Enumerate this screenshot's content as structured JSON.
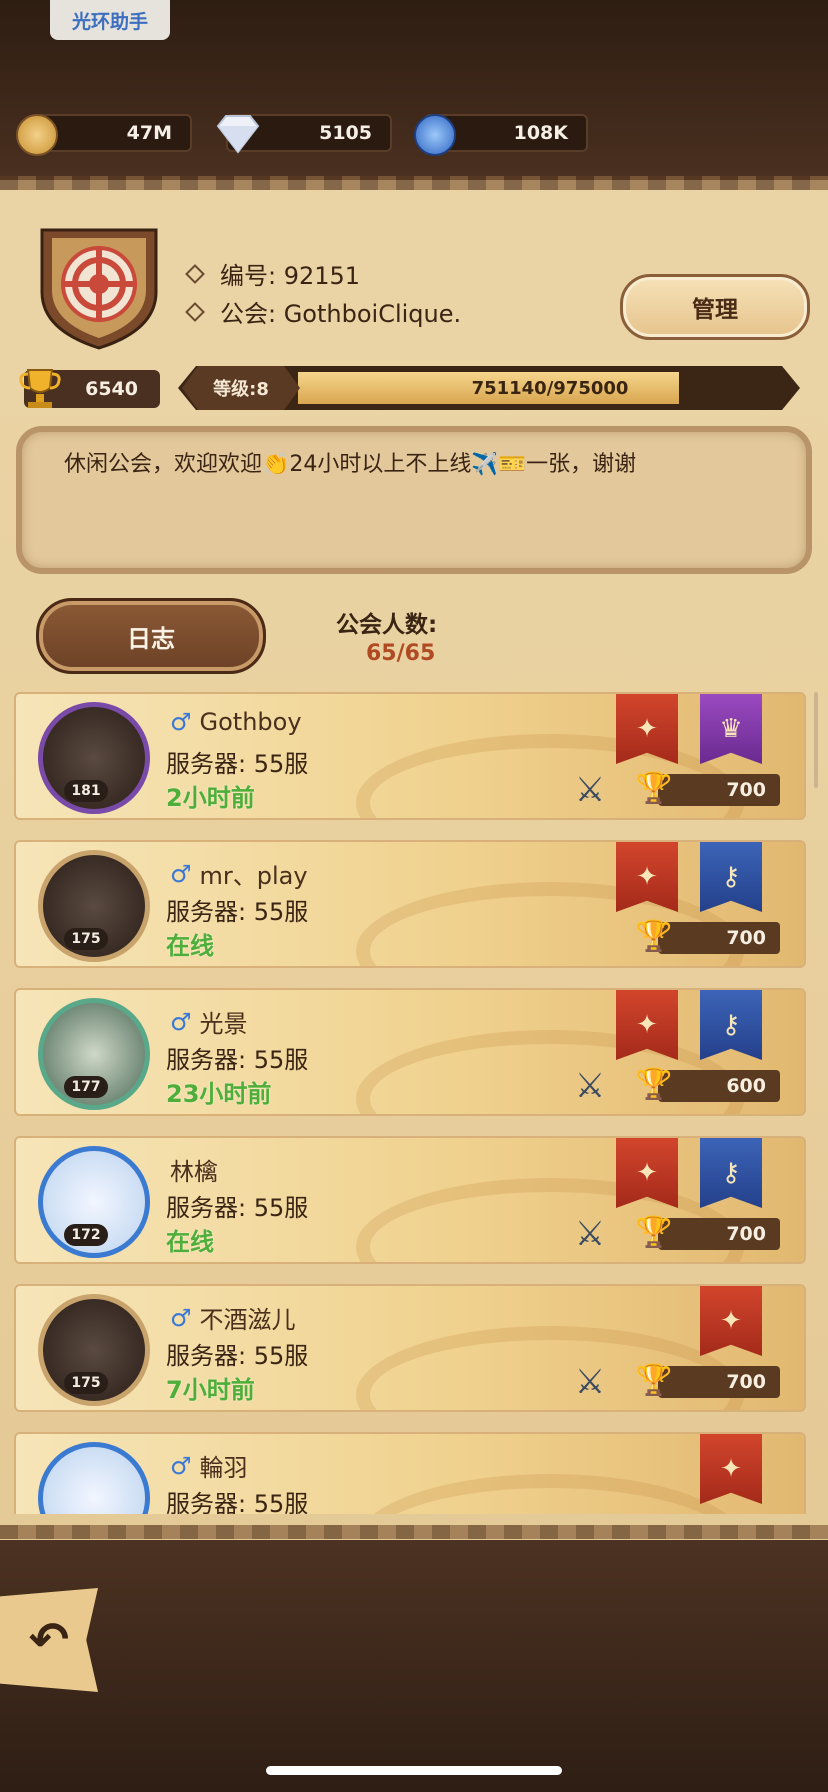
{
  "system": {
    "assistant_label": "光环助手"
  },
  "resources": [
    {
      "icon": "gold-coin-icon",
      "value": "47M"
    },
    {
      "icon": "diamond-icon",
      "value": "5105"
    },
    {
      "icon": "blue-gem-icon",
      "value": "108K"
    }
  ],
  "guild": {
    "id_label": "编号: 92151",
    "name_label": "公会: GothboiClique.",
    "manage_label": "管理",
    "trophies": "6540",
    "level_label": "等级:8",
    "xp_text": "751140/975000",
    "xp_fraction": 0.7704,
    "notice": "休闲公会，欢迎欢迎👏24小时以上不上线✈️🎫一张，谢谢",
    "log_label": "日志",
    "member_count_label": "公会人数:",
    "member_count": "65/65"
  },
  "members": [
    {
      "name": "Gothboy",
      "male": true,
      "level": "181",
      "server": "服务器: 55服",
      "status": "2小时前",
      "points": "700",
      "banners": [
        "red",
        "purple"
      ],
      "crossed_swords": true,
      "frame": "purple"
    },
    {
      "name": "mr、play",
      "male": true,
      "level": "175",
      "server": "服务器: 55服",
      "status": "在线",
      "points": "700",
      "banners": [
        "red",
        "blue"
      ],
      "crossed_swords": false,
      "frame": "gold"
    },
    {
      "name": "光景",
      "male": true,
      "level": "177",
      "server": "服务器: 55服",
      "status": "23小时前",
      "points": "600",
      "banners": [
        "red",
        "blue"
      ],
      "crossed_swords": true,
      "frame": "green"
    },
    {
      "name": "林檎",
      "male": false,
      "level": "172",
      "server": "服务器: 55服",
      "status": "在线",
      "points": "700",
      "banners": [
        "red",
        "blue"
      ],
      "crossed_swords": true,
      "frame": "blue"
    },
    {
      "name": "不酒滋儿",
      "male": true,
      "level": "175",
      "server": "服务器: 55服",
      "status": "7小时前",
      "points": "700",
      "banners": [
        "red"
      ],
      "crossed_swords": true,
      "frame": "gold"
    },
    {
      "name": "輪羽",
      "male": true,
      "level": "",
      "server": "服务器: 55服",
      "status": "",
      "points": "",
      "banners": [
        "red"
      ],
      "crossed_swords": true,
      "frame": "blue"
    }
  ],
  "colors": {
    "online": "#4fae3a",
    "count": "#b04a22",
    "male": "#3a78d6"
  }
}
